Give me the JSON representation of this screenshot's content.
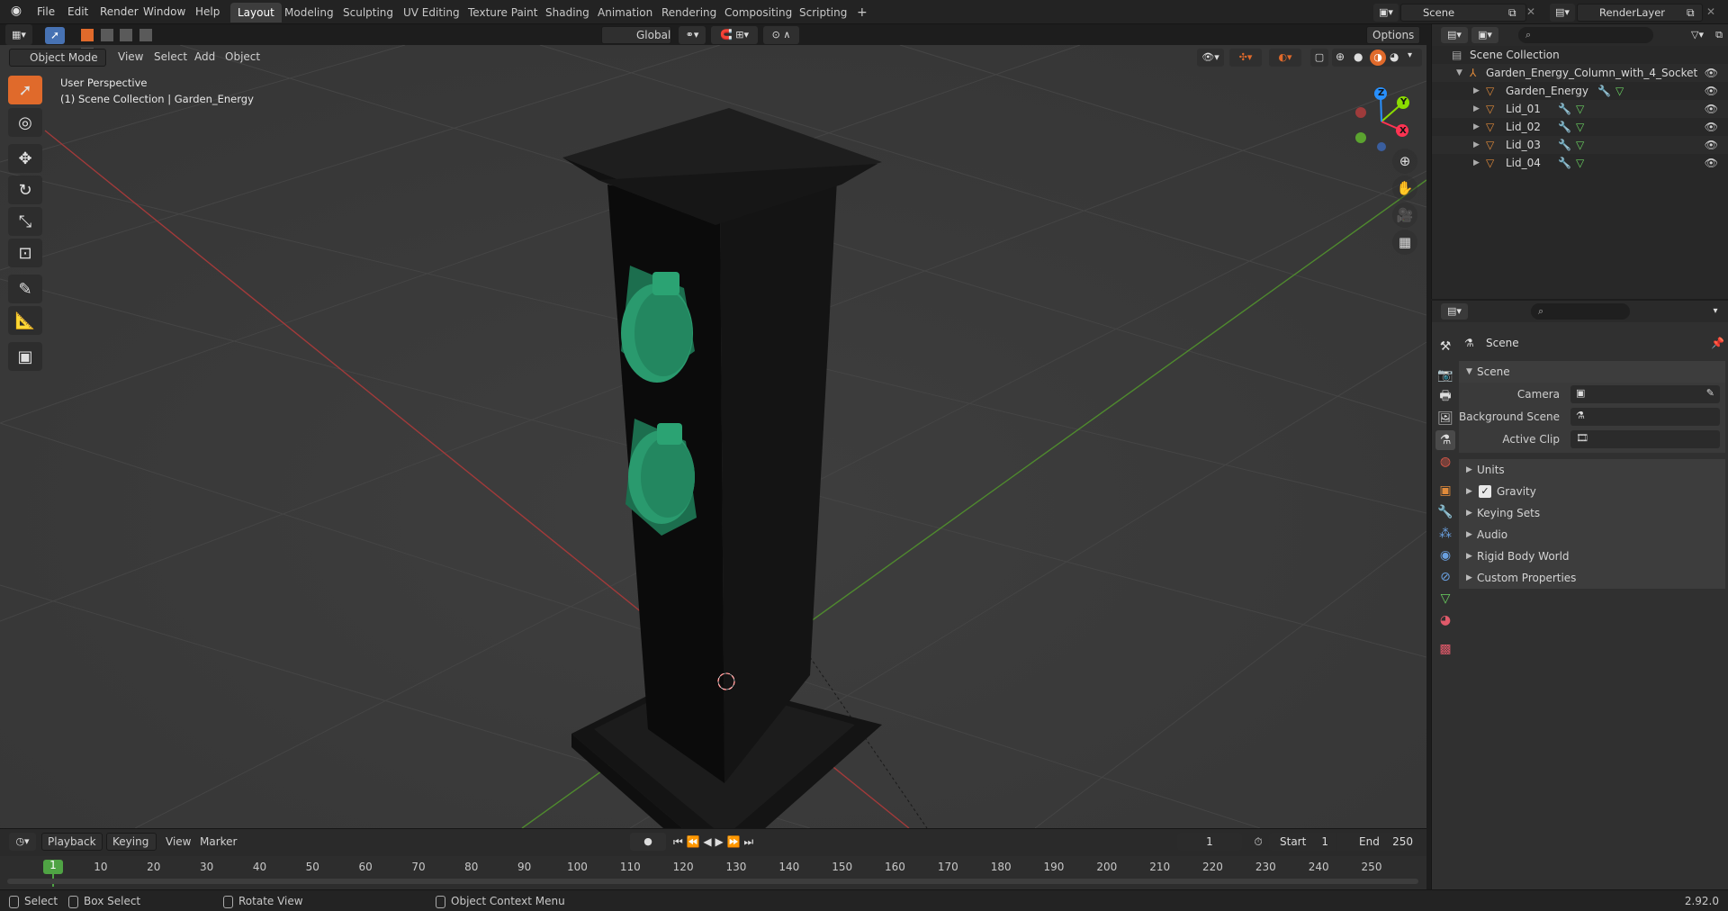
{
  "menus": [
    "File",
    "Edit",
    "Render",
    "Window",
    "Help"
  ],
  "workspaces": [
    "Layout",
    "Modeling",
    "Sculpting",
    "UV Editing",
    "Texture Paint",
    "Shading",
    "Animation",
    "Rendering",
    "Compositing",
    "Scripting"
  ],
  "active_workspace": "Layout",
  "add_workspace_label": "+",
  "scene_field": "Scene",
  "renderlayer_field": "RenderLayer",
  "header": {
    "mode": "Object Mode",
    "menus": [
      "View",
      "Select",
      "Add",
      "Object"
    ],
    "transform_orientation": "Global",
    "options": "Options"
  },
  "viewport": {
    "perspective_label": "User Perspective",
    "collection_label": "(1) Scene Collection | Garden_Energy",
    "axis_x": "X",
    "axis_y": "Y",
    "axis_z": "Z"
  },
  "outliner": {
    "root": "Scene Collection",
    "collection": "Garden_Energy_Column_with_4_Socket",
    "objects": [
      "Garden_Energy",
      "Lid_01",
      "Lid_02",
      "Lid_03",
      "Lid_04"
    ]
  },
  "properties": {
    "context_title": "Scene",
    "panel_title": "Scene",
    "camera_label": "Camera",
    "background_scene_label": "Background Scene",
    "active_clip_label": "Active Clip",
    "subpanels": [
      "Units",
      "Gravity",
      "Keying Sets",
      "Audio",
      "Rigid Body World",
      "Custom Properties"
    ],
    "gravity_checked": true
  },
  "timeline": {
    "menus": [
      "Playback",
      "Keying",
      "View",
      "Marker"
    ],
    "current_frame": "1",
    "start_label": "Start",
    "start_value": "1",
    "end_label": "End",
    "end_value": "250",
    "ticks": [
      "1",
      "10",
      "20",
      "30",
      "40",
      "50",
      "60",
      "70",
      "80",
      "90",
      "100",
      "110",
      "120",
      "130",
      "140",
      "150",
      "160",
      "170",
      "180",
      "190",
      "200",
      "210",
      "220",
      "230",
      "240",
      "250"
    ]
  },
  "statusbar": {
    "select": "Select",
    "box_select": "Box Select",
    "rotate_view": "Rotate View",
    "context_menu": "Object Context Menu",
    "version": "2.92.0"
  },
  "colors": {
    "accent": "#4772b3",
    "active_tool": "#e06a2b",
    "x_axis": "#ff3352",
    "y_axis": "#8bdc00",
    "z_axis": "#2890ff",
    "socket_green": "#2a9a6e"
  }
}
